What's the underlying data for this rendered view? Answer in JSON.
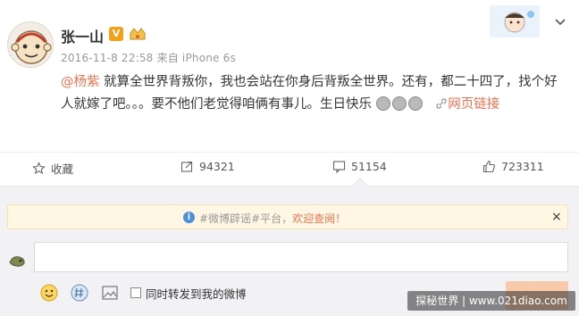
{
  "post": {
    "username": "张一山",
    "verified_badge": "V",
    "meta": "2016-11-8 22:58 来自 iPhone 6s",
    "content": {
      "mention": "@杨紫",
      "text": " 就算全世界背叛你，我也会站在你身后背叛全世界。还有，都二十四了，找个好人就嫁了吧。。。要不他们老觉得咱俩有事儿。生日快乐",
      "link": "网页链接"
    },
    "icons": {
      "avatar": "monkey-king-avatar",
      "level": "member-level-icon",
      "menu": "chevron-down-icon",
      "link": "link-icon",
      "emoji": "laughing-emoji-icon"
    }
  },
  "actions": {
    "favorite_label": "收藏",
    "forward_count": "94321",
    "comment_count": "51154",
    "like_count": "723311"
  },
  "comment": {
    "notice_text": "#微博辟谣#平台，",
    "notice_link": "欢迎查阅！",
    "notice_close": "×",
    "forward_label": "同时转发到我的微博",
    "icons": [
      "smiley-icon",
      "topic-icon",
      "image-icon"
    ]
  },
  "watermark": "探秘世界 | www.021diao.com",
  "colors": {
    "accent": "#eb7350",
    "panel_bg": "#f2f2f5",
    "notice_bg": "#fff7e4",
    "submit_bg": "#f9c9ab",
    "verified": "#f2a21a"
  }
}
